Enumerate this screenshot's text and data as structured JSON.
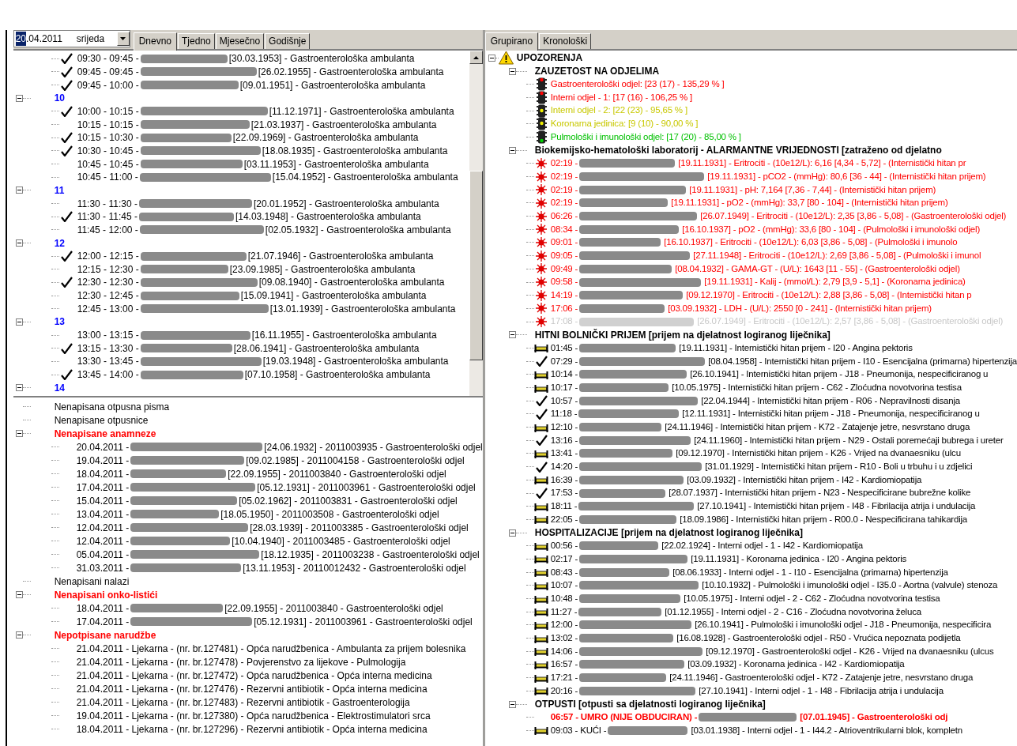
{
  "date_picker": {
    "day": "20",
    "day_highlighted": true,
    "rest": ".04.2011",
    "weekday": "srijeda"
  },
  "view_tabs": [
    {
      "label": "Dnevno",
      "selected": true
    },
    {
      "label": "Tjedno",
      "selected": false
    },
    {
      "label": "Mjesečno",
      "selected": false
    },
    {
      "label": "Godišnje",
      "selected": false
    }
  ],
  "schedule": [
    {
      "children": [
        {
          "checked": true,
          "time": "09:30 - 09:45 -",
          "details": "[30.03.1953] - Gastroenterološka ambulanta"
        },
        {
          "checked": true,
          "time": "09:45 - 09:45 -",
          "details": "[26.02.1955] - Gastroenterološka ambulanta"
        },
        {
          "checked": true,
          "time": "09:45 - 10:00 -",
          "details": "[09.01.1951] - Gastroenterološka ambulanta"
        }
      ]
    },
    {
      "label": "10",
      "expanded": true,
      "children": [
        {
          "checked": true,
          "time": "10:00 - 10:15 -",
          "details": "[11.12.1971] - Gastroenterološka ambulanta"
        },
        {
          "checked": false,
          "time": "10:15 - 10:15 -",
          "details": "[21.03.1937] - Gastroenterološka ambulanta"
        },
        {
          "checked": true,
          "time": "10:15 - 10:30 -",
          "details": "[22.09.1969] - Gastroenterološka ambulanta"
        },
        {
          "checked": true,
          "time": "10:30 - 10:45 -",
          "details": "[18.08.1935] - Gastroenterološka ambulanta"
        },
        {
          "checked": false,
          "time": "10:45 - 10:45 -",
          "details": "[03.11.1953] - Gastroenterološka ambulanta"
        },
        {
          "checked": false,
          "time": "10:45 - 11:00 -",
          "details": "[15.04.1952] - Gastroenterološka ambulanta"
        }
      ]
    },
    {
      "label": "11",
      "expanded": true,
      "children": [
        {
          "checked": false,
          "time": "11:30 - 11:30 -",
          "details": "[20.01.1952] - Gastroenterološka ambulanta"
        },
        {
          "checked": true,
          "time": "11:30 - 11:45 -",
          "details": "[14.03.1948] - Gastroenterološka ambulanta"
        },
        {
          "checked": false,
          "time": "11:45 - 12:00 -",
          "details": "[02.05.1932] - Gastroenterološka ambulanta"
        }
      ]
    },
    {
      "label": "12",
      "expanded": true,
      "children": [
        {
          "checked": true,
          "time": "12:00 - 12:15 -",
          "details": "[21.07.1946] - Gastroenterološka ambulanta"
        },
        {
          "checked": false,
          "time": "12:15 - 12:30 -",
          "details": "[23.09.1985] - Gastroenterološka ambulanta"
        },
        {
          "checked": true,
          "time": "12:30 - 12:30 -",
          "details": "[09.08.1940] - Gastroenterološka ambulanta"
        },
        {
          "checked": false,
          "time": "12:30 - 12:45 -",
          "details": "[15.09.1941] - Gastroenterološka ambulanta"
        },
        {
          "checked": false,
          "time": "12:45 - 13:00 -",
          "details": "[13.01.1939] - Gastroenterološka ambulanta"
        }
      ]
    },
    {
      "label": "13",
      "expanded": true,
      "children": [
        {
          "checked": false,
          "time": "13:00 - 13:15 -",
          "details": "[16.11.1955] - Gastroenterološka ambulanta"
        },
        {
          "checked": true,
          "time": "13:15 - 13:30 -",
          "details": "[28.06.1941] - Gastroenterološka ambulanta"
        },
        {
          "checked": false,
          "time": "13:30 - 13:45 -",
          "details": "[19.03.1948] - Gastroenterološka ambulanta"
        },
        {
          "checked": true,
          "time": "13:45 - 14:00 -",
          "details": "[07.10.1958] - Gastroenterološka ambulanta"
        }
      ]
    },
    {
      "label": "14",
      "expanded": true
    }
  ],
  "worklist": [
    {
      "label": "Nenapisana otpusna pisma",
      "alert": false
    },
    {
      "label": "Nenapisane otpusnice",
      "alert": false
    },
    {
      "label": "Nenapisane anamneze",
      "alert": true,
      "expanded": true,
      "children": [
        {
          "date": "20.04.2011 -",
          "details": "[24.06.1932] - 2011003935 - Gastroenterološki odjel"
        },
        {
          "date": "19.04.2011 -",
          "details": "[09.02.1985] - 2011004158 - Gastroenterološki odjel"
        },
        {
          "date": "18.04.2011 -",
          "details": "[22.09.1955] - 2011003840 - Gastroenterološki odjel"
        },
        {
          "date": "17.04.2011 -",
          "details": "[05.12.1931] - 2011003961 - Gastroenterološki odjel"
        },
        {
          "date": "15.04.2011 -",
          "details": "[05.02.1962] - 2011003831 - Gastroenterološki odjel"
        },
        {
          "date": "13.04.2011 -",
          "details": "[18.05.1950] - 2011003508 - Gastroenterološki odjel"
        },
        {
          "date": "12.04.2011 -",
          "details": "[28.03.1939] - 2011003385 - Gastroenterološki odjel"
        },
        {
          "date": "12.04.2011 -",
          "details": "[10.04.1940] - 2011003485 - Gastroenterološki odjel"
        },
        {
          "date": "05.04.2011 -",
          "details": "[18.12.1935] - 2011003238 - Gastroenterološki odjel"
        },
        {
          "date": "31.03.2011 -",
          "details": "[13.11.1953] - 20110012432 - Gastroenterološki odjel"
        }
      ]
    },
    {
      "label": "Nenapisani nalazi",
      "alert": false
    },
    {
      "label": "Nenapisani onko-listići",
      "alert": true,
      "expanded": true,
      "children": [
        {
          "date": "18.04.2011 -",
          "details": "[22.09.1955] - 2011003840 - Gastroenterološki odjel"
        },
        {
          "date": "17.04.2011 -",
          "details": "[05.12.1931] - 2011003961 - Gastroenterološki odjel"
        }
      ]
    },
    {
      "label": "Nepotpisane narudžbe",
      "alert": true,
      "expanded": true,
      "children": [
        {
          "text": "21.04.2011 - Ljekarna - (nr. br.127481) - Opća narudžbenica - Ambulanta za prijem bolesnika"
        },
        {
          "text": "21.04.2011 - Ljekarna - (nr. br.127478) - Povjerenstvo za lijekove - Pulmologija"
        },
        {
          "text": "21.04.2011 - Ljekarna - (nr. br.127472) - Opća narudžbenica - Opća interna medicina"
        },
        {
          "text": "21.04.2011 - Ljekarna - (nr. br.127476) - Rezervni antibiotik - Opća interna medicina"
        },
        {
          "text": "21.04.2011 - Ljekarna - (nr. br.127483) - Rezervni antibiotik - Gastroenterologija"
        },
        {
          "text": "19.04.2011 - Ljekarna - (nr. br.127380) - Opća narudžbenica - Elektrostimulatori srca"
        },
        {
          "text": "18.04.2011 - Ljekarna - (nr. br.127296) - Rezervni antibiotik - Opća interna medicina"
        }
      ]
    }
  ],
  "overview_tabs": [
    {
      "label": "Grupirano",
      "selected": true
    },
    {
      "label": "Kronološki",
      "selected": false
    }
  ],
  "alerts": {
    "title": "UPOZORENJA",
    "expanded": true,
    "sections": [
      {
        "title": "ZAUZETOST NA ODJELIMA",
        "expanded": true,
        "children": [
          {
            "kind": "traffic_light",
            "color": "#ff0000",
            "text": "Gastroenterološki odjel: [23 (17) - 135,29 % ]"
          },
          {
            "kind": "traffic_light",
            "color": "#ff0000",
            "text": "Interni odjel - 1: [17 (16) - 106,25 % ]"
          },
          {
            "kind": "traffic_light",
            "color": "#c8c800",
            "text": "Interni odjel - 2: [22 (23) - 95,65 % ]"
          },
          {
            "kind": "traffic_light",
            "color": "#c8c800",
            "text": "Koronarna jedinica: [9 (10) - 90,00 % ]"
          },
          {
            "kind": "traffic_light",
            "color": "#00c000",
            "text": "Pulmološki i imunološki odjel: [17 (20) - 85,00 % ]"
          }
        ]
      },
      {
        "title": "Biokemijsko-hematološki laboratorij - ALARMANTNE VRIJEDNOSTI [zatraženo od djelatno",
        "expanded": true,
        "children": [
          {
            "kind": "alarm",
            "faded": false,
            "time": "02:19 -",
            "details": "[19.11.1931] - Eritrociti - (10e12/L): 6,16 [4,34 - 5,72] - (Internistički hitan pr"
          },
          {
            "kind": "alarm",
            "faded": false,
            "time": "02:19 -",
            "details": "[19.11.1931] - pCO2 - (mmHg): 80,6 [36 - 44] - (Internistički hitan prijem)"
          },
          {
            "kind": "alarm",
            "faded": false,
            "time": "02:19 -",
            "details": "[19.11.1931] - pH: 7,164 [7,36 - 7,44] - (Internistički hitan prijem)"
          },
          {
            "kind": "alarm",
            "faded": false,
            "time": "02:19 -",
            "details": "[19.11.1931] - pO2 - (mmHg): 33,7 [80 - 104] - (Internistički hitan prijem)"
          },
          {
            "kind": "alarm",
            "faded": false,
            "time": "06:26 -",
            "details": "[26.07.1949] - Eritrociti - (10e12/L): 2,35 [3,86 - 5,08] - (Gastroenterološki odjel)"
          },
          {
            "kind": "alarm",
            "faded": false,
            "time": "08:34 -",
            "details": "[16.10.1937] - pO2 - (mmHg): 33,6 [80 - 104] - (Pulmološki i imunološki odjel)"
          },
          {
            "kind": "alarm",
            "faded": false,
            "time": "09:01 -",
            "details": "[16.10.1937] - Eritrociti - (10e12/L): 6,03 [3,86 - 5,08] - (Pulmološki i imunolo"
          },
          {
            "kind": "alarm",
            "faded": false,
            "time": "09:05 -",
            "details": "[27.11.1948] - Eritrociti - (10e12/L): 2,69 [3,86 - 5,08] - (Pulmološki i imunol"
          },
          {
            "kind": "alarm",
            "faded": false,
            "time": "09:49 -",
            "details": "[08.04.1932] - GAMA-GT - (U/L): 1643 [11 - 55] - (Gastroenterološki odjel)"
          },
          {
            "kind": "alarm",
            "faded": false,
            "time": "09:58 -",
            "details": "[19.11.1931] - Kalij - (mmol/L): 2,79 [3,9 - 5,1] - (Koronarna jedinica)"
          },
          {
            "kind": "alarm",
            "faded": false,
            "time": "14:19 -",
            "details": "[09.12.1970] - Eritrociti - (10e12/L): 2,88 [3,86 - 5,08] - (Internistički hitan p"
          },
          {
            "kind": "alarm",
            "faded": false,
            "time": "17:06 -",
            "details": "[03.09.1932] - LDH - (U/L): 2550 [0 - 241] - (Internistički hitan prijem)"
          },
          {
            "kind": "alarm",
            "faded": true,
            "time": "17:08 -",
            "details": "[26.07.1949] - Eritrociti - (10e12/L): 2,57 [3,86 - 5,08] - (Gastroenterološki odjel)"
          }
        ]
      },
      {
        "title": "HITNI BOLNIČKI PRIJEM [prijem na djelatnost logiranog liječnika]",
        "expanded": true,
        "children": [
          {
            "kind": "bed",
            "time": "01:45 -",
            "details": "[19.11.1931] - Internistički hitan prijem - I20 - Angina pektoris"
          },
          {
            "kind": "check",
            "time": "07:29 -",
            "details": "[08.04.1958] - Internistički hitan prijem - I10 - Esencijalna (primarna) hipertenzija"
          },
          {
            "kind": "bed",
            "time": "10:14 -",
            "details": "[26.10.1941] - Internistički hitan prijem - J18 - Pneumonija, nespecificiranog u"
          },
          {
            "kind": "bed",
            "time": "10:17 -",
            "details": "[10.05.1975] - Internistički hitan prijem - C62 - Zloćudna novotvorina testisa"
          },
          {
            "kind": "check",
            "time": "10:57 -",
            "details": "[22.04.1944] - Internistički hitan prijem - R06 - Nepravilnosti disanja"
          },
          {
            "kind": "check",
            "time": "11:18 -",
            "details": "[12.11.1931] - Internistički hitan prijem - J18 - Pneumonija, nespecificiranog u"
          },
          {
            "kind": "bed",
            "time": "12:10 -",
            "details": "[24.11.1946] - Internistički hitan prijem - K72 - Zatajenje jetre, nesvrstano druga"
          },
          {
            "kind": "check",
            "time": "13:16 -",
            "details": "[24.11.1960] - Internistički hitan prijem - N29 - Ostali poremećaji bubrega i ureter"
          },
          {
            "kind": "bed",
            "time": "13:41 -",
            "details": "[09.12.1970] - Internistički hitan prijem - K26 - Vrijed na dvanaesniku (ulcu"
          },
          {
            "kind": "check",
            "time": "14:20 -",
            "details": "[31.01.1929] - Internistički hitan prijem - R10 - Boli u trbuhu i u zdjelici"
          },
          {
            "kind": "bed",
            "time": "16:39 -",
            "details": "[03.09.1932] - Internistički hitan prijem - I42 - Kardiomiopatija"
          },
          {
            "kind": "check",
            "time": "17:53 -",
            "details": "[28.07.1937] - Internistički hitan prijem - N23 - Nespecificirane bubrežne kolike"
          },
          {
            "kind": "bed",
            "time": "18:11 -",
            "details": "[27.10.1941] - Internistički hitan prijem - I48 - Fibrilacija atrija i undulacija"
          },
          {
            "kind": "bed",
            "time": "22:05 -",
            "details": "[18.09.1986] - Internistički hitan prijem - R00.0 - Nespecificirana tahikardija"
          }
        ]
      },
      {
        "title": "HOSPITALIZACIJE [prijem na djelatnost logiranog liječnika]",
        "expanded": true,
        "children": [
          {
            "kind": "bed",
            "time": "00:56 -",
            "details": "[22.02.1924] - Interni odjel - 1 - I42 - Kardiomiopatija"
          },
          {
            "kind": "bed",
            "time": "02:17 -",
            "details": "[19.11.1931] - Koronarna jedinica - I20 - Angina pektoris"
          },
          {
            "kind": "bed",
            "time": "08:43 -",
            "details": "[08.06.1933] - Interni odjel - 1 - I10 - Esencijalna (primarna) hipertenzija"
          },
          {
            "kind": "bed",
            "time": "10:07 -",
            "details": "[10.10.1932] - Pulmološki i imunološki odjel - I35.0 - Aortna (valvule) stenoza"
          },
          {
            "kind": "bed",
            "time": "10:48 -",
            "details": "[10.05.1975] - Interni odjel - 2 - C62 - Zloćudna novotvorina testisa"
          },
          {
            "kind": "bed",
            "time": "11:27 -",
            "details": "[01.12.1955] - Interni odjel - 2 - C16 - Zloćudna novotvorina želuca"
          },
          {
            "kind": "bed",
            "time": "12:00 -",
            "details": "[26.10.1941] - Pulmološki i imunološki odjel - J18 - Pneumonija, nespecificira"
          },
          {
            "kind": "bed",
            "time": "13:02 -",
            "details": "[16.08.1928] - Gastroenterološki odjel - R50 - Vrućica nepoznata podijetla"
          },
          {
            "kind": "bed",
            "time": "14:06 -",
            "details": "[09.12.1970] - Gastroenterološki odjel - K26 - Vrijed na dvanaesniku (ulcus"
          },
          {
            "kind": "bed",
            "time": "16:57 -",
            "details": "[03.09.1932] - Koronarna jedinica - I42 - Kardiomiopatija"
          },
          {
            "kind": "bed",
            "time": "17:21 -",
            "details": "[24.11.1946] - Gastroenterološki odjel - K72 - Zatajenje jetre, nesvrstano druga"
          },
          {
            "kind": "bed",
            "time": "20:16 -",
            "details": "[27.10.1941] - Interni odjel - 1 - I48 - Fibrilacija atrija i undulacija"
          }
        ]
      },
      {
        "title": "OTPUSTI [otpusti sa djelatnosti logiranog liječnika]",
        "expanded": true,
        "children": [
          {
            "kind": "death",
            "time": "06:57 - UMRO (NIJE OBDUCIRAN) -",
            "details": "[07.01.1945] - Gastroenterološki odj"
          },
          {
            "kind": "bed",
            "time": "09:03 - KUĆI -",
            "details": "[03.01.1938] - Interni odjel - 1 - I44.2 - Atrioventrikularni blok, kompletn"
          }
        ]
      }
    ]
  }
}
